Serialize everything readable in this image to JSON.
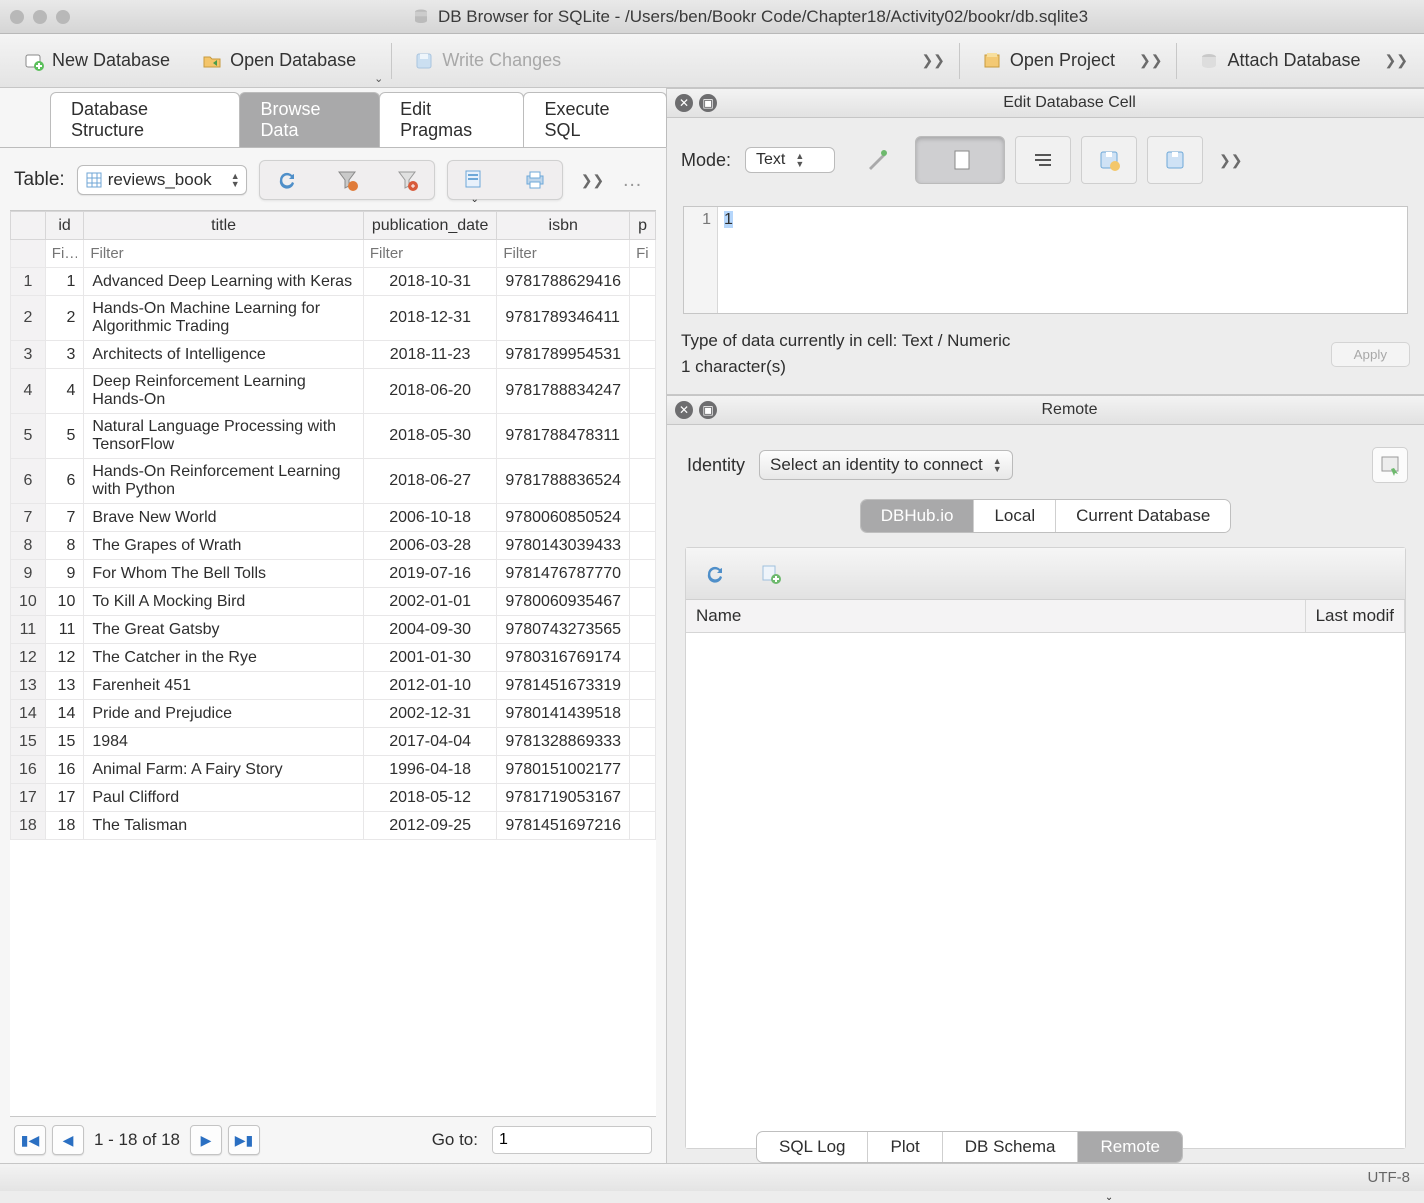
{
  "window": {
    "title": "DB Browser for SQLite - /Users/ben/Bookr Code/Chapter18/Activity02/bookr/db.sqlite3"
  },
  "toolbar": {
    "newdb": "New Database",
    "opendb": "Open Database",
    "writechanges": "Write Changes",
    "openproj": "Open Project",
    "attach": "Attach Database"
  },
  "tabs": {
    "structure": "Database Structure",
    "browse": "Browse Data",
    "pragmas": "Edit Pragmas",
    "sql": "Execute SQL"
  },
  "browse": {
    "table_label": "Table:",
    "table_name": "reviews_book",
    "columns": {
      "id": "id",
      "title": "title",
      "pub": "publication_date",
      "isbn": "isbn",
      "p": "p"
    },
    "filter_placeholder_short": "Fi…",
    "filter_placeholder": "Filter",
    "rows": [
      {
        "n": "1",
        "id": "1",
        "title": "Advanced Deep Learning with Keras",
        "pub": "2018-10-31",
        "isbn": "9781788629416"
      },
      {
        "n": "2",
        "id": "2",
        "title": "Hands-On Machine Learning for Algorithmic Trading",
        "pub": "2018-12-31",
        "isbn": "9781789346411"
      },
      {
        "n": "3",
        "id": "3",
        "title": "Architects of Intelligence",
        "pub": "2018-11-23",
        "isbn": "9781789954531"
      },
      {
        "n": "4",
        "id": "4",
        "title": "Deep Reinforcement Learning Hands-On",
        "pub": "2018-06-20",
        "isbn": "9781788834247"
      },
      {
        "n": "5",
        "id": "5",
        "title": "Natural Language Processing with TensorFlow",
        "pub": "2018-05-30",
        "isbn": "9781788478311"
      },
      {
        "n": "6",
        "id": "6",
        "title": "Hands-On Reinforcement Learning with Python",
        "pub": "2018-06-27",
        "isbn": "9781788836524"
      },
      {
        "n": "7",
        "id": "7",
        "title": "Brave New World",
        "pub": "2006-10-18",
        "isbn": "9780060850524"
      },
      {
        "n": "8",
        "id": "8",
        "title": "The Grapes of Wrath",
        "pub": "2006-03-28",
        "isbn": "9780143039433"
      },
      {
        "n": "9",
        "id": "9",
        "title": "For Whom The Bell Tolls",
        "pub": "2019-07-16",
        "isbn": "9781476787770"
      },
      {
        "n": "10",
        "id": "10",
        "title": "To Kill A Mocking Bird",
        "pub": "2002-01-01",
        "isbn": "9780060935467"
      },
      {
        "n": "11",
        "id": "11",
        "title": "The Great Gatsby",
        "pub": "2004-09-30",
        "isbn": "9780743273565"
      },
      {
        "n": "12",
        "id": "12",
        "title": "The Catcher in the Rye",
        "pub": "2001-01-30",
        "isbn": "9780316769174"
      },
      {
        "n": "13",
        "id": "13",
        "title": "Farenheit 451",
        "pub": "2012-01-10",
        "isbn": "9781451673319"
      },
      {
        "n": "14",
        "id": "14",
        "title": "Pride and Prejudice",
        "pub": "2002-12-31",
        "isbn": "9780141439518"
      },
      {
        "n": "15",
        "id": "15",
        "title": "1984",
        "pub": "2017-04-04",
        "isbn": "9781328869333"
      },
      {
        "n": "16",
        "id": "16",
        "title": "Animal Farm: A Fairy Story",
        "pub": "1996-04-18",
        "isbn": "9780151002177"
      },
      {
        "n": "17",
        "id": "17",
        "title": "Paul Clifford",
        "pub": "2018-05-12",
        "isbn": "9781719053167"
      },
      {
        "n": "18",
        "id": "18",
        "title": "The Talisman",
        "pub": "2012-09-25",
        "isbn": "9781451697216"
      }
    ],
    "pager": {
      "range": "1 - 18 of 18",
      "goto_label": "Go to:",
      "goto_value": "1"
    }
  },
  "editcell": {
    "panel_title": "Edit Database Cell",
    "mode_label": "Mode:",
    "mode_value": "Text",
    "line_no": "1",
    "cell_value": "1",
    "type_info": "Type of data currently in cell: Text / Numeric",
    "char_info": "1 character(s)",
    "apply": "Apply"
  },
  "remote": {
    "panel_title": "Remote",
    "identity_label": "Identity",
    "identity_value": "Select an identity to connect",
    "tabs": {
      "dbhub": "DBHub.io",
      "local": "Local",
      "current": "Current Database"
    },
    "headers": {
      "name": "Name",
      "last": "Last modif"
    }
  },
  "bottom_tabs": {
    "sqllog": "SQL Log",
    "plot": "Plot",
    "schema": "DB Schema",
    "remote": "Remote"
  },
  "statusbar": {
    "encoding": "UTF-8"
  }
}
